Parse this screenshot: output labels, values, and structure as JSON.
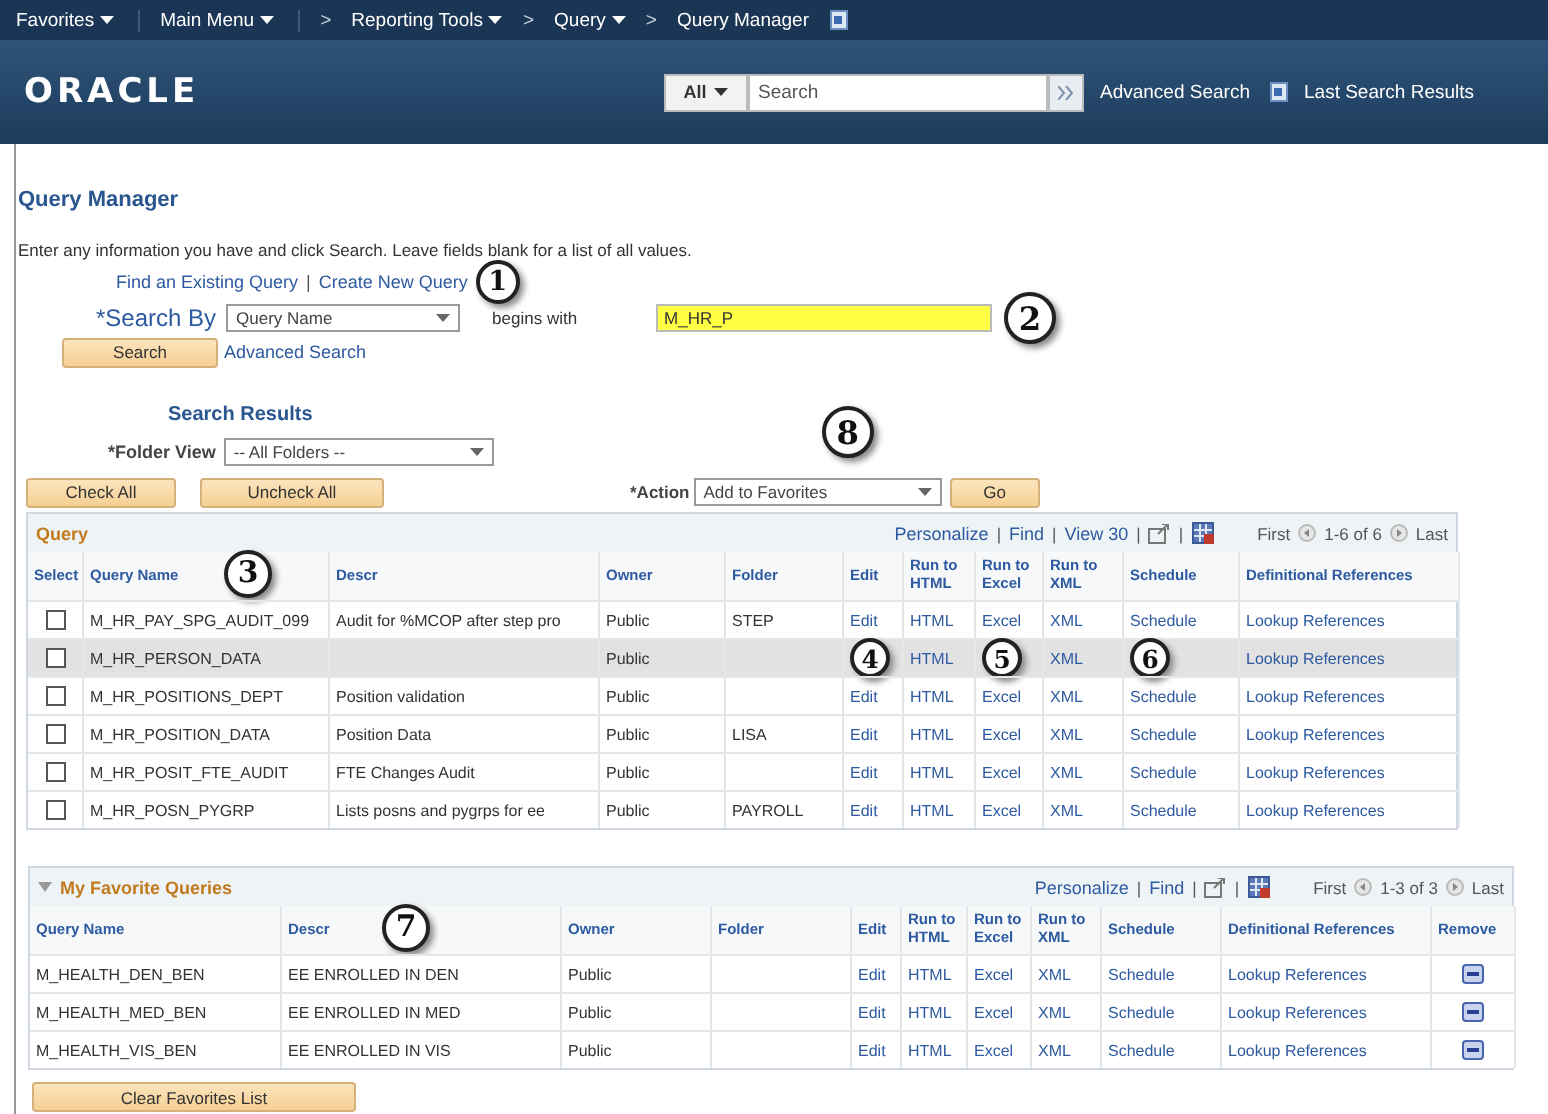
{
  "nav_bar": {
    "items": [
      {
        "label": "Favorites",
        "has_menu": true
      },
      {
        "label": "Main Menu",
        "has_menu": true
      },
      {
        "label": "Reporting Tools",
        "has_menu": true
      },
      {
        "label": "Query",
        "has_menu": true
      },
      {
        "label": "Query Manager",
        "has_menu": false
      }
    ],
    "separator": ">"
  },
  "header": {
    "logo": "ORACLE",
    "scope": "All",
    "search_placeholder": "Search",
    "advanced_search": "Advanced Search",
    "last_results": "Last Search Results"
  },
  "page_title": "Query Manager",
  "instructions": "Enter any information you have and click Search. Leave fields blank for a list of all values.",
  "links": {
    "items": [
      "Find an Existing Query",
      "Create New Query"
    ],
    "separator": "|",
    "callout": "1"
  },
  "search": {
    "label": "*Search By",
    "field": "Query Name",
    "operator": "begins with",
    "value": "M_HR_P",
    "callout": "2",
    "button": "Search",
    "advanced": "Advanced Search"
  },
  "results": {
    "title": "Search Results",
    "folder_label": "*Folder View",
    "folder_value": "-- All Folders --",
    "check_all": "Check All",
    "uncheck_all": "Uncheck All",
    "action_label": "*Action",
    "action_value": "Add to Favorites",
    "go": "Go",
    "callout": "8"
  },
  "query_table": {
    "title": "Query",
    "tools": [
      "Personalize",
      "Find",
      "View 30"
    ],
    "separator": "|",
    "first": "First",
    "range": "1-6 of 6",
    "last": "Last",
    "header_callout": "3",
    "select_column": "Select",
    "columns": [
      "Query Name",
      "Descr",
      "Owner",
      "Folder",
      "Edit",
      "Run to HTML",
      "Run to Excel",
      "Run to XML",
      "Schedule",
      "Definitional References"
    ],
    "rows": [
      {
        "highlighted": false,
        "checked": false,
        "cells": [
          "M_HR_PAY_SPG_AUDIT_099",
          "Audit for %MCOP after step pro",
          "Public",
          "STEP"
        ],
        "actions": [
          {
            "kind": "link",
            "text": "Edit"
          },
          {
            "kind": "link",
            "text": "HTML"
          },
          {
            "kind": "link",
            "text": "Excel"
          },
          {
            "kind": "link",
            "text": "XML"
          },
          {
            "kind": "link",
            "text": "Schedule"
          },
          {
            "kind": "link",
            "text": "Lookup References"
          }
        ]
      },
      {
        "highlighted": true,
        "checked": false,
        "cells": [
          "M_HR_PERSON_DATA",
          "",
          "Public",
          ""
        ],
        "actions": [
          {
            "kind": "callout",
            "text": "4"
          },
          {
            "kind": "link",
            "text": "HTML"
          },
          {
            "kind": "callout",
            "text": "5"
          },
          {
            "kind": "link",
            "text": "XML"
          },
          {
            "kind": "callout",
            "text": "6"
          },
          {
            "kind": "link",
            "text": "Lookup References"
          }
        ]
      },
      {
        "highlighted": false,
        "checked": false,
        "cells": [
          "M_HR_POSITIONS_DEPT",
          "Position validation",
          "Public",
          ""
        ],
        "actions": [
          {
            "kind": "link",
            "text": "Edit"
          },
          {
            "kind": "link",
            "text": "HTML"
          },
          {
            "kind": "link",
            "text": "Excel"
          },
          {
            "kind": "link",
            "text": "XML"
          },
          {
            "kind": "link",
            "text": "Schedule"
          },
          {
            "kind": "link",
            "text": "Lookup References"
          }
        ]
      },
      {
        "highlighted": false,
        "checked": false,
        "cells": [
          "M_HR_POSITION_DATA",
          "Position Data",
          "Public",
          "LISA"
        ],
        "actions": [
          {
            "kind": "link",
            "text": "Edit"
          },
          {
            "kind": "link",
            "text": "HTML"
          },
          {
            "kind": "link",
            "text": "Excel"
          },
          {
            "kind": "link",
            "text": "XML"
          },
          {
            "kind": "link",
            "text": "Schedule"
          },
          {
            "kind": "link",
            "text": "Lookup References"
          }
        ]
      },
      {
        "highlighted": false,
        "checked": false,
        "cells": [
          "M_HR_POSIT_FTE_AUDIT",
          "FTE Changes Audit",
          "Public",
          ""
        ],
        "actions": [
          {
            "kind": "link",
            "text": "Edit"
          },
          {
            "kind": "link",
            "text": "HTML"
          },
          {
            "kind": "link",
            "text": "Excel"
          },
          {
            "kind": "link",
            "text": "XML"
          },
          {
            "kind": "link",
            "text": "Schedule"
          },
          {
            "kind": "link",
            "text": "Lookup References"
          }
        ]
      },
      {
        "highlighted": false,
        "checked": false,
        "cells": [
          "M_HR_POSN_PYGRP",
          "Lists posns and pygrps for ee",
          "Public",
          "PAYROLL"
        ],
        "actions": [
          {
            "kind": "link",
            "text": "Edit"
          },
          {
            "kind": "link",
            "text": "HTML"
          },
          {
            "kind": "link",
            "text": "Excel"
          },
          {
            "kind": "link",
            "text": "XML"
          },
          {
            "kind": "link",
            "text": "Schedule"
          },
          {
            "kind": "link",
            "text": "Lookup References"
          }
        ]
      }
    ]
  },
  "favorites": {
    "title": "My Favorite Queries",
    "expanded": true,
    "tools": [
      "Personalize",
      "Find"
    ],
    "separator": "|",
    "first": "First",
    "range": "1-3 of 3",
    "last": "Last",
    "header_callout": "7",
    "columns": [
      "Query Name",
      "Descr",
      "Owner",
      "Folder",
      "Edit",
      "Run to HTML",
      "Run to Excel",
      "Run to XML",
      "Schedule",
      "Definitional References",
      "Remove"
    ],
    "rows": [
      {
        "cells": [
          "M_HEALTH_DEN_BEN",
          "EE ENROLLED IN DEN",
          "Public",
          ""
        ],
        "actions": [
          "Edit",
          "HTML",
          "Excel",
          "XML",
          "Schedule",
          "Lookup References"
        ]
      },
      {
        "cells": [
          "M_HEALTH_MED_BEN",
          "EE ENROLLED IN MED",
          "Public",
          ""
        ],
        "actions": [
          "Edit",
          "HTML",
          "Excel",
          "XML",
          "Schedule",
          "Lookup References"
        ]
      },
      {
        "cells": [
          "M_HEALTH_VIS_BEN",
          "EE ENROLLED IN VIS",
          "Public",
          ""
        ],
        "actions": [
          "Edit",
          "HTML",
          "Excel",
          "XML",
          "Schedule",
          "Lookup References"
        ]
      }
    ],
    "clear_button": "Clear Favorites List"
  }
}
